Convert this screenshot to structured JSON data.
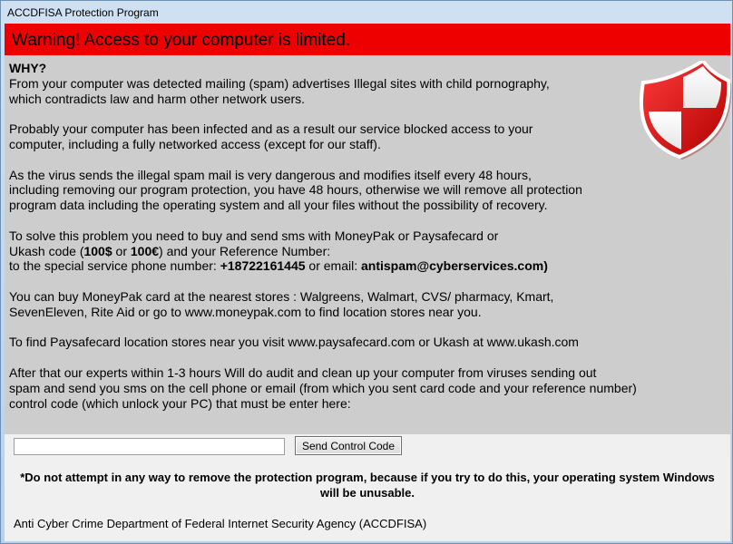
{
  "window": {
    "title": "ACCDFISA Protection Program"
  },
  "banner": {
    "text": "Warning! Access to your computer is limited."
  },
  "message": {
    "why": "WHY?",
    "p1": "From your computer was detected mailing (spam) advertises Illegal sites with child pornography,\nwhich contradicts law and harm other network users.",
    "p2": "Probably your computer has been infected and as a result our service blocked access to your\ncomputer, including a fully networked access (except for our staff).",
    "p3": "As the virus sends the illegal spam mail is very dangerous and modifies itself every 48 hours,\nincluding removing our program protection, you have 48 hours, otherwise we will remove all protection\nprogram data including the operating system and all your files without the possibility of recovery.",
    "p4_line1": "To solve this problem you need to buy and send sms with MoneyPak or Paysafecard or",
    "p4_line2_a": "Ukash code (",
    "price_usd": "100$",
    "p4_line2_b": " or ",
    "price_eur": "100€",
    "p4_line2_c": ") and your Reference Number:",
    "p4_line3_a": "to the special service phone number: ",
    "phone": "+18722161445",
    "p4_line3_b": " or email: ",
    "email": "antispam@cyberservices.com)",
    "p5": "You can buy MoneyPak card at the nearest stores : Walgreens, Walmart, CVS/ pharmacy, Kmart,\nSevenEleven, Rite Aid  or go to www.moneypak.com to find location stores near you.",
    "p6": "To find Paysafecard location stores near you visit www.paysafecard.com or Ukash at www.ukash.com",
    "p7": "After that our experts within 1-3 hours  Will do audit and clean up your computer from viruses sending out\nspam and send you sms on the cell phone or email (from which you sent card code and your reference number)\ncontrol code (which unlock your PC) that must be enter here:"
  },
  "code_input": {
    "value": ""
  },
  "send_button": {
    "label": "Send Control Code"
  },
  "warning": {
    "text": "*Do not attempt in any way to remove the protection program, because if you try to do this, your operating system Windows will be unusable."
  },
  "footer": {
    "text": "Anti Cyber Crime Department of Federal Internet Security Agency (ACCDFISA)"
  },
  "colors": {
    "banner": "#ee0000",
    "panel": "#cdcdcd",
    "shield": "#d00000"
  },
  "icons": {
    "shield": "shield-icon"
  }
}
